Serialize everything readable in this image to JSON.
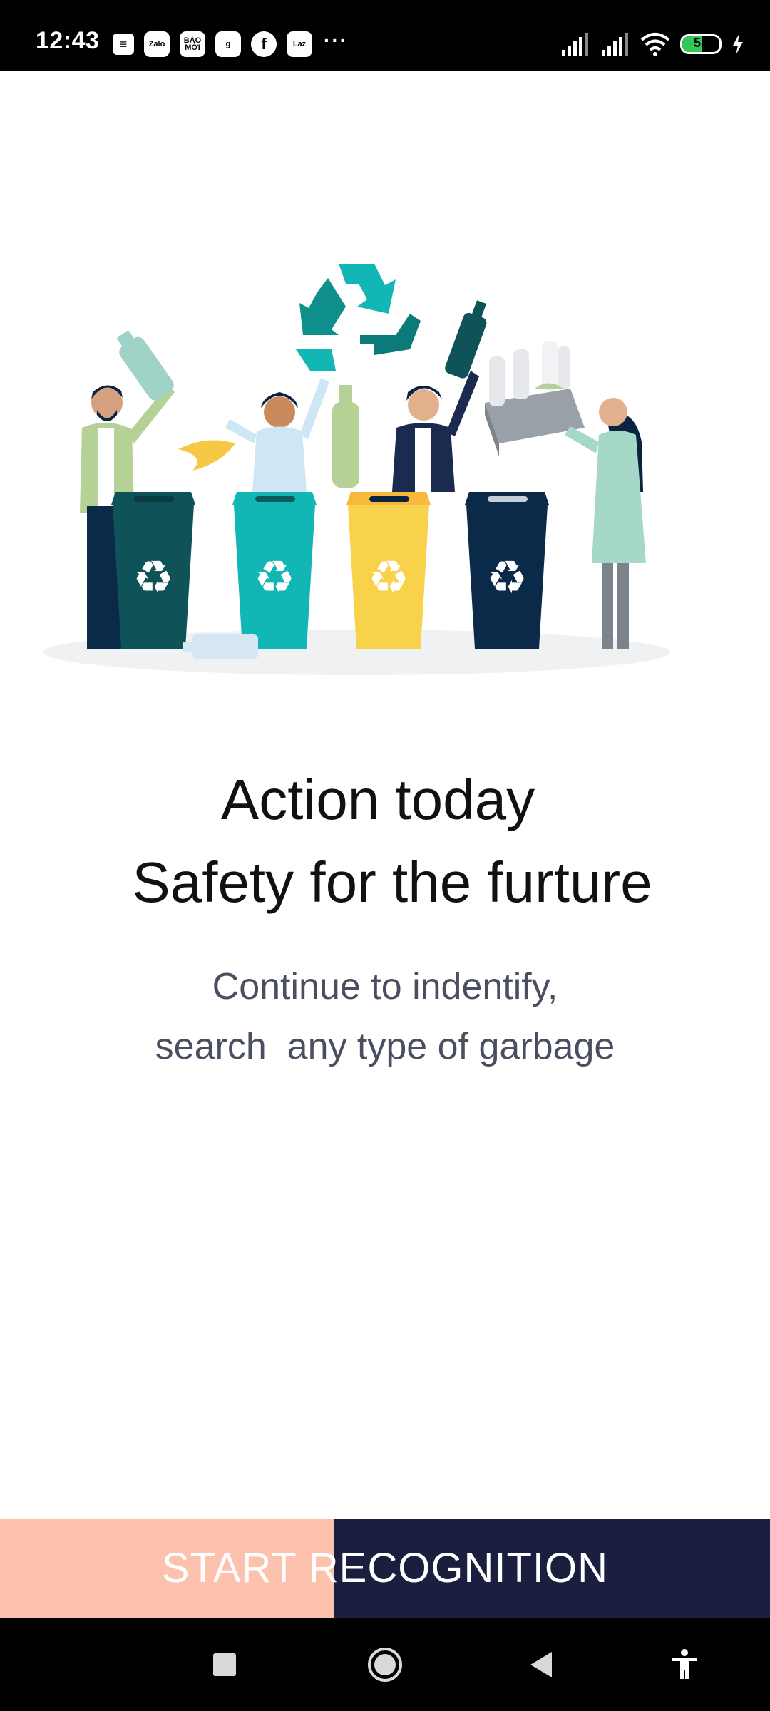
{
  "status_bar": {
    "time": "12:43",
    "notifications": [
      {
        "icon": "doc-icon",
        "label": "≡"
      },
      {
        "icon": "zalo-icon",
        "label": "Zalo"
      },
      {
        "icon": "baomoi-icon",
        "label": "BÁO MỚI"
      },
      {
        "icon": "g-app-icon",
        "label": "g"
      },
      {
        "icon": "facebook-icon",
        "label": "f"
      },
      {
        "icon": "lazada-icon",
        "label": "Laz"
      }
    ],
    "more": "···",
    "battery_level": "52",
    "battery_fraction": 0.52
  },
  "illustration": {
    "name": "recycling-people-illustration",
    "bin_colors": [
      "#0f5257",
      "#12b6b4",
      "#f9d24b",
      "#0b2a4a"
    ]
  },
  "content": {
    "headline_line1": "Action today",
    "headline_line2": "Safety for the furture",
    "subtitle_line1": "Continue to indentify,",
    "subtitle_line2": "search  any type of garbage"
  },
  "start_button": {
    "label": "START RECOGNITION",
    "progress_fraction": 0.433,
    "bg_color": "#1b1f3f",
    "progress_color": "#fdc2ad"
  },
  "nav_bar": {
    "buttons": [
      "recents-icon",
      "home-icon",
      "back-icon",
      "accessibility-icon"
    ]
  }
}
